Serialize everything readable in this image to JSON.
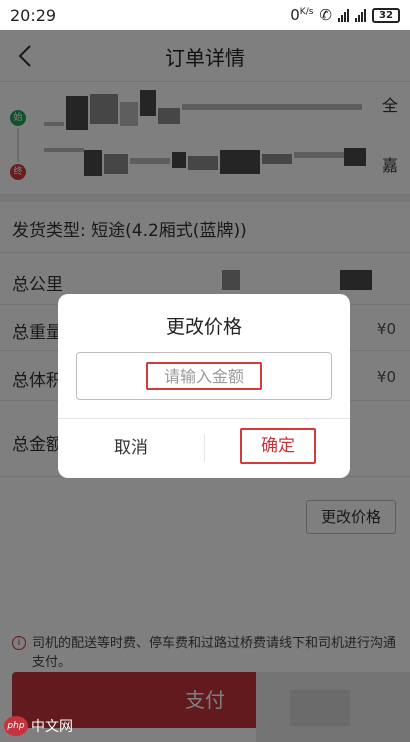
{
  "status_bar": {
    "time": "20:29",
    "net_speed": "0",
    "net_unit": "K/s",
    "network_label": "4G",
    "battery": "32"
  },
  "nav": {
    "title": "订单详情",
    "back_icon": "chevron-left-icon"
  },
  "route": {
    "start_label": "始",
    "end_label": "终",
    "start_suffix": "全",
    "end_suffix": "嘉"
  },
  "details": {
    "cargo_type_label": "发货类型:",
    "cargo_type_value": "短途(4.2厢式(蓝牌))",
    "total_distance_label": "总公里",
    "total_weight_label": "总重量",
    "total_weight_value": "¥0",
    "total_volume_label": "总体积",
    "total_volume_value": "¥0",
    "total_amount_label": "总金额"
  },
  "change_price_button": "更改价格",
  "notice": "司机的配送等时费、停车费和过路过桥费请线下和司机进行沟通支付。",
  "pay_button": "支付",
  "watermark": {
    "logo": "php",
    "text": "中文网"
  },
  "dialog": {
    "title": "更改价格",
    "input_placeholder": "请输入金额",
    "input_value": "",
    "cancel_label": "取消",
    "confirm_label": "确定"
  },
  "colors": {
    "accent_red": "#c4343f",
    "highlight_red": "#d33b3b",
    "start_green": "#27a35b"
  }
}
